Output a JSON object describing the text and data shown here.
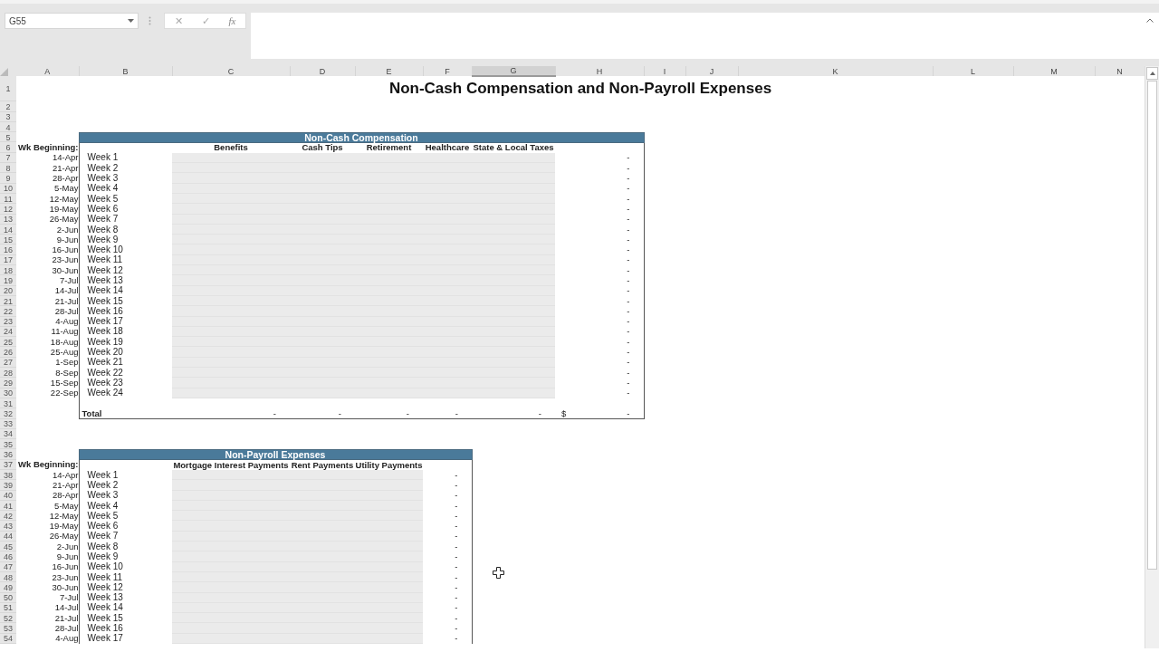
{
  "name_box": "G55",
  "formula_buttons": [
    {
      "kind": "cancel",
      "text": "✕"
    },
    {
      "kind": "enter",
      "text": "✓"
    },
    {
      "kind": "function",
      "text": "fx"
    }
  ],
  "columns": [
    {
      "label": "A",
      "selected": false
    },
    {
      "label": "B",
      "selected": false
    },
    {
      "label": "C",
      "selected": false
    },
    {
      "label": "D",
      "selected": false
    },
    {
      "label": "E",
      "selected": false
    },
    {
      "label": "F",
      "selected": false
    },
    {
      "label": "G",
      "selected": true
    },
    {
      "label": "H",
      "selected": false
    },
    {
      "label": "I",
      "selected": false
    },
    {
      "label": "J",
      "selected": false
    },
    {
      "label": "K",
      "selected": false
    },
    {
      "label": "L",
      "selected": false
    },
    {
      "label": "M",
      "selected": false
    },
    {
      "label": "N",
      "selected": false
    }
  ],
  "row_numbers": [
    "1",
    "2",
    "3",
    "4",
    "5",
    "6",
    "7",
    "8",
    "9",
    "10",
    "11",
    "12",
    "13",
    "14",
    "15",
    "16",
    "17",
    "18",
    "19",
    "20",
    "21",
    "22",
    "23",
    "24",
    "25",
    "26",
    "27",
    "28",
    "29",
    "30",
    "31",
    "32",
    "33",
    "34",
    "35",
    "36",
    "37",
    "38",
    "39",
    "40",
    "41",
    "42",
    "43",
    "44",
    "45",
    "46",
    "47",
    "48",
    "49",
    "50",
    "51",
    "52",
    "53",
    "54"
  ],
  "title": "Non-Cash Compensation and Non-Payroll Expenses",
  "sections": [
    {
      "title": "Non-Cash Compensation",
      "label": "Wk Beginning:",
      "columns": [
        "Benefits",
        "Cash Tips",
        "Retirement",
        "Healthcare",
        "State & Local Taxes"
      ],
      "rows": [
        {
          "date": "14-Apr",
          "week": "Week 1",
          "total": "-"
        },
        {
          "date": "21-Apr",
          "week": "Week 2",
          "total": "-"
        },
        {
          "date": "28-Apr",
          "week": "Week 3",
          "total": "-"
        },
        {
          "date": "5-May",
          "week": "Week 4",
          "total": "-"
        },
        {
          "date": "12-May",
          "week": "Week 5",
          "total": "-"
        },
        {
          "date": "19-May",
          "week": "Week 6",
          "total": "-"
        },
        {
          "date": "26-May",
          "week": "Week 7",
          "total": "-"
        },
        {
          "date": "2-Jun",
          "week": "Week 8",
          "total": "-"
        },
        {
          "date": "9-Jun",
          "week": "Week 9",
          "total": "-"
        },
        {
          "date": "16-Jun",
          "week": "Week 10",
          "total": "-"
        },
        {
          "date": "23-Jun",
          "week": "Week 11",
          "total": "-"
        },
        {
          "date": "30-Jun",
          "week": "Week 12",
          "total": "-"
        },
        {
          "date": "7-Jul",
          "week": "Week 13",
          "total": "-"
        },
        {
          "date": "14-Jul",
          "week": "Week 14",
          "total": "-"
        },
        {
          "date": "21-Jul",
          "week": "Week 15",
          "total": "-"
        },
        {
          "date": "28-Jul",
          "week": "Week 16",
          "total": "-"
        },
        {
          "date": "4-Aug",
          "week": "Week 17",
          "total": "-"
        },
        {
          "date": "11-Aug",
          "week": "Week 18",
          "total": "-"
        },
        {
          "date": "18-Aug",
          "week": "Week 19",
          "total": "-"
        },
        {
          "date": "25-Aug",
          "week": "Week 20",
          "total": "-"
        },
        {
          "date": "1-Sep",
          "week": "Week 21",
          "total": "-"
        },
        {
          "date": "8-Sep",
          "week": "Week 22",
          "total": "-"
        },
        {
          "date": "15-Sep",
          "week": "Week 23",
          "total": "-"
        },
        {
          "date": "22-Sep",
          "week": "Week 24",
          "total": "-"
        }
      ],
      "total_row": {
        "label": "Total",
        "values": [
          "-",
          "-",
          "-",
          "-",
          "-"
        ],
        "currency": "$",
        "total": "-"
      }
    },
    {
      "title": "Non-Payroll Expenses",
      "label": "Wk Beginning:",
      "columns": [
        "Mortgage Interest Payments",
        "Rent Payments",
        "Utility Payments"
      ],
      "rows": [
        {
          "date": "14-Apr",
          "week": "Week 1",
          "total": "-"
        },
        {
          "date": "21-Apr",
          "week": "Week 2",
          "total": "-"
        },
        {
          "date": "28-Apr",
          "week": "Week 3",
          "total": "-"
        },
        {
          "date": "5-May",
          "week": "Week 4",
          "total": "-"
        },
        {
          "date": "12-May",
          "week": "Week 5",
          "total": "-"
        },
        {
          "date": "19-May",
          "week": "Week 6",
          "total": "-"
        },
        {
          "date": "26-May",
          "week": "Week 7",
          "total": "-"
        },
        {
          "date": "2-Jun",
          "week": "Week 8",
          "total": "-"
        },
        {
          "date": "9-Jun",
          "week": "Week 9",
          "total": "-"
        },
        {
          "date": "16-Jun",
          "week": "Week 10",
          "total": "-"
        },
        {
          "date": "23-Jun",
          "week": "Week 11",
          "total": "-"
        },
        {
          "date": "30-Jun",
          "week": "Week 12",
          "total": "-"
        },
        {
          "date": "7-Jul",
          "week": "Week 13",
          "total": "-"
        },
        {
          "date": "14-Jul",
          "week": "Week 14",
          "total": "-"
        },
        {
          "date": "21-Jul",
          "week": "Week 15",
          "total": "-"
        },
        {
          "date": "28-Jul",
          "week": "Week 16",
          "total": "-"
        },
        {
          "date": "4-Aug",
          "week": "Week 17",
          "total": "-"
        }
      ]
    }
  ]
}
